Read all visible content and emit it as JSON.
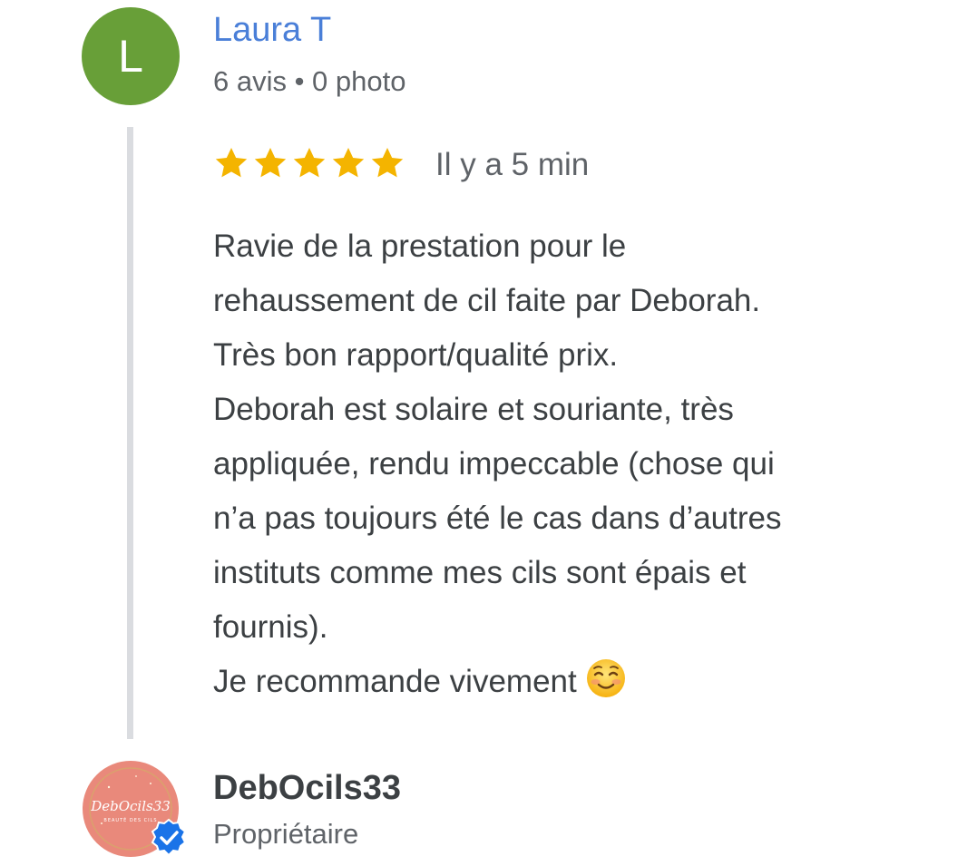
{
  "review": {
    "author_initial": "L",
    "author_name": "Laura T",
    "author_meta": "6 avis • 0 photo",
    "rating": 5,
    "max_rating": 5,
    "time": "Il y a 5 min",
    "text_lines": [
      "Ravie de la prestation pour le",
      "rehaussement de cil faite par Deborah.",
      "Très bon rapport/qualité prix.",
      "Deborah est solaire et souriante, très",
      "appliquée, rendu impeccable (chose qui",
      "n’a pas toujours été le cas dans d’autres",
      "instituts comme mes cils sont épais et",
      "fournis).",
      "Je recommande vivement"
    ],
    "emoji": "smiling-face-emoji"
  },
  "owner": {
    "name": "DebOcils33",
    "role": "Propriétaire",
    "logo_text": "DebOcils33",
    "logo_subtext": "BEAUTÉ DES CILS"
  },
  "colors": {
    "avatar_bg": "#689f38",
    "name_link": "#4a7fd8",
    "star": "#f4b400",
    "verified": "#1a73e8",
    "owner_logo_bg": "#e9897b"
  }
}
